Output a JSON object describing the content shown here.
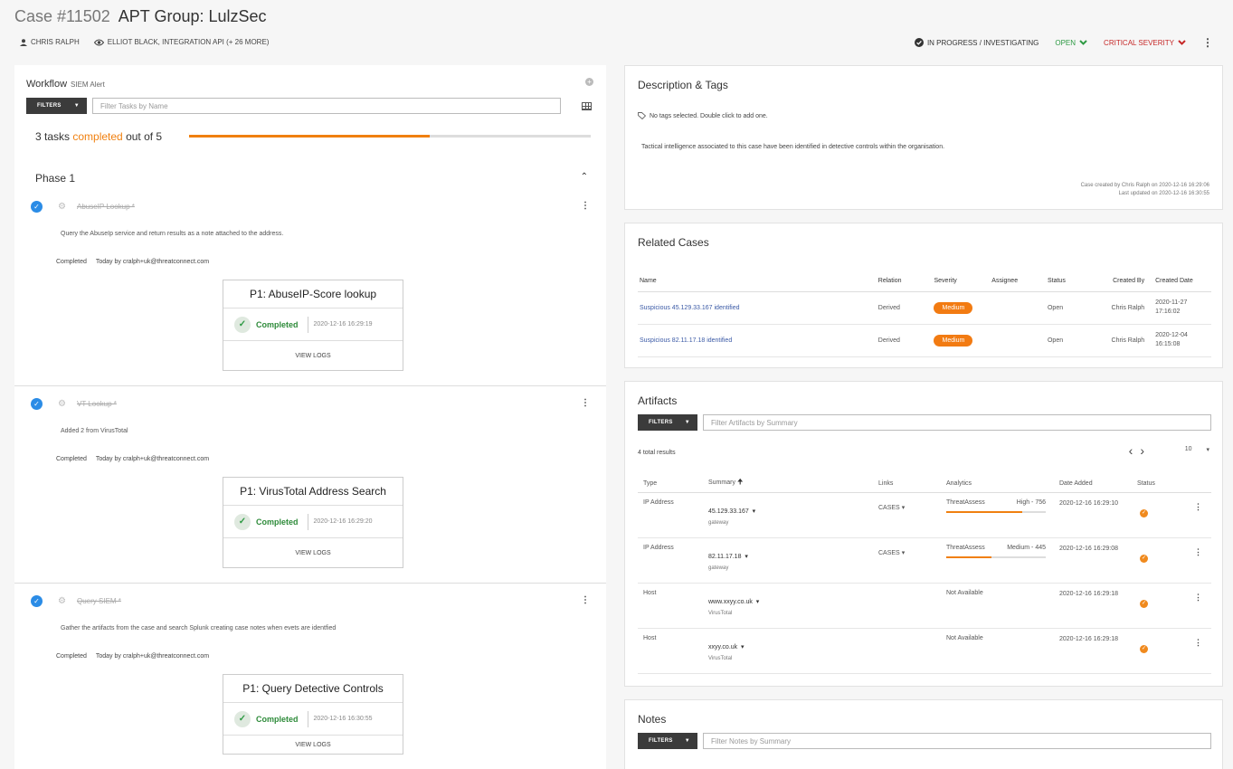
{
  "header": {
    "case_number": "Case #11502",
    "title": "APT Group: LulzSec",
    "owner": "CHRIS RALPH",
    "watchers": "ELLIOT BLACK, INTEGRATION API (+ 26 MORE)",
    "status": "IN PROGRESS / INVESTIGATING",
    "resolution": "OPEN",
    "severity": "CRITICAL SEVERITY",
    "colors": {
      "open": "#2e9a44",
      "critical": "#c62828",
      "accent": "#f08010"
    }
  },
  "workflow": {
    "title": "Workflow",
    "subtitle": "SIEM Alert",
    "filters_label": "FILTERS",
    "filter_placeholder": "Filter Tasks by Name",
    "progress_prefix": "3 tasks",
    "progress_highlight": "completed",
    "progress_suffix": "out of 5",
    "progress_fraction": 0.6,
    "phase": "Phase 1",
    "tasks": [
      {
        "name": "AbuseIP Lookup *",
        "description": "Query the AbuseIp service and return results as a note attached to the address.",
        "status": "Completed",
        "by": "Today by cralph+uk@threatconnect.com",
        "card_title": "P1: AbuseIP-Score lookup",
        "card_status": "Completed",
        "card_date": "2020-12-16 16:29:19",
        "card_link": "VIEW LOGS"
      },
      {
        "name": "VT Lookup *",
        "description": "Added 2 from VirusTotal",
        "status": "Completed",
        "by": "Today by cralph+uk@threatconnect.com",
        "card_title": "P1: VirusTotal Address Search",
        "card_status": "Completed",
        "card_date": "2020-12-16 16:29:20",
        "card_link": "VIEW LOGS"
      },
      {
        "name": "Query SIEM *",
        "description": "Gather the artifacts from the case and search Splunk creating case notes when evets are identfied",
        "status": "Completed",
        "by": "Today by cralph+uk@threatconnect.com",
        "card_title": "P1: Query Detective Controls",
        "card_status": "Completed",
        "card_date": "2020-12-16 16:30:55",
        "card_link": "VIEW LOGS"
      }
    ]
  },
  "description": {
    "title": "Description & Tags",
    "tags_text": "No tags selected.  Double click to add one.",
    "body": "Tactical intelligence associated to this case have been identified in detective controls within the organisation.",
    "created": "Case created by Chris Ralph on 2020-12-16 16:29:06",
    "updated": "Last updated on 2020-12-16 16:30:55"
  },
  "related": {
    "title": "Related Cases",
    "columns": [
      "Name",
      "Relation",
      "Severity",
      "Assignee",
      "Status",
      "Created By",
      "Created Date"
    ],
    "rows": [
      {
        "name": "Suspicious 45.129.33.167 identified",
        "relation": "Derived",
        "severity": "Medium",
        "assignee": "",
        "status": "Open",
        "created_by": "Chris Ralph",
        "created_date": "2020-11-27 17:16:02"
      },
      {
        "name": "Suspicious 82.11.17.18 identified",
        "relation": "Derived",
        "severity": "Medium",
        "assignee": "",
        "status": "Open",
        "created_by": "Chris Ralph",
        "created_date": "2020-12-04 16:15:08"
      }
    ]
  },
  "artifacts": {
    "title": "Artifacts",
    "filters_label": "FILTERS",
    "filter_placeholder": "Filter Artifacts by Summary",
    "total": "4 total results",
    "page_size": "10",
    "columns": [
      "Type",
      "Summary",
      "Links",
      "Analytics",
      "Date Added",
      "Status"
    ],
    "rows": [
      {
        "type": "IP Address",
        "summary": "45.129.33.167",
        "source": "gateway",
        "links": "CASES",
        "analytic_name": "ThreatAssess",
        "analytic_value": "High - 756",
        "analytic_fraction": 0.76,
        "date": "2020-12-16 16:29:10"
      },
      {
        "type": "IP Address",
        "summary": "82.11.17.18",
        "source": "gateway",
        "links": "CASES",
        "analytic_name": "ThreatAssess",
        "analytic_value": "Medium - 445",
        "analytic_fraction": 0.45,
        "date": "2020-12-16 16:29:08"
      },
      {
        "type": "Host",
        "summary": "www.xxyy.co.uk",
        "source": "VirusTotal",
        "links": "",
        "analytic_name": "Not Available",
        "analytic_value": "",
        "analytic_fraction": null,
        "date": "2020-12-16 16:29:18"
      },
      {
        "type": "Host",
        "summary": "xxyy.co.uk",
        "source": "VirusTotal",
        "links": "",
        "analytic_name": "Not Available",
        "analytic_value": "",
        "analytic_fraction": null,
        "date": "2020-12-16 16:29:18"
      }
    ]
  },
  "notes": {
    "title": "Notes",
    "filters_label": "FILTERS",
    "filter_placeholder": "Filter Notes by Summary"
  }
}
